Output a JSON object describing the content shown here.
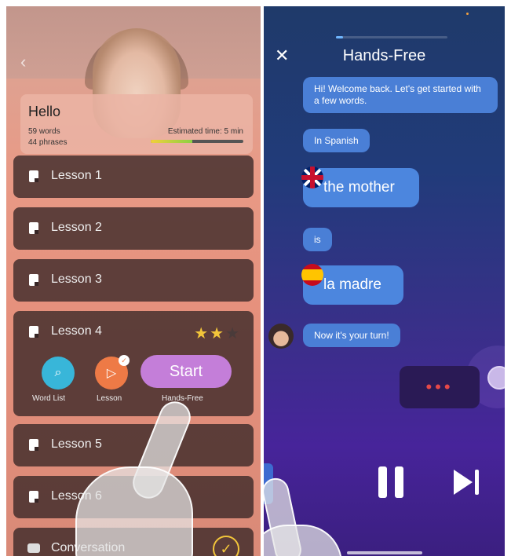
{
  "left_screen": {
    "back_icon": "chevron-left-icon",
    "header": {
      "title": "Hello",
      "words": "59 words",
      "phrases": "44 phrases",
      "estimated_time": "Estimated time: 5 min",
      "time_progress": 0.45
    },
    "lessons": [
      {
        "label": "Lesson 1"
      },
      {
        "label": "Lesson 2"
      },
      {
        "label": "Lesson 3"
      },
      {
        "label": "Lesson 4",
        "stars": 2,
        "stars_max": 3
      },
      {
        "label": "Lesson 5"
      },
      {
        "label": "Lesson 6"
      },
      {
        "label": "Conversation",
        "completed": true
      }
    ],
    "lesson4_actions": {
      "word_list": "Word List",
      "lesson": "Lesson",
      "start": "Start",
      "hands_free": "Hands-Free"
    },
    "colors": {
      "accent_star": "#f2c53a",
      "start_button": "#c47ed9",
      "word_list_button": "#38b6d9",
      "lesson_button": "#ee7a46"
    }
  },
  "right_screen": {
    "close_icon": "close-icon",
    "title": "Hands-Free",
    "progress": 0.06,
    "messages": [
      {
        "text": "Hi! Welcome back. Let's get started with a few words."
      },
      {
        "text": "In Spanish"
      },
      {
        "text": "the mother",
        "flag": "uk-flag-icon"
      },
      {
        "text": "is"
      },
      {
        "text": "la madre",
        "flag": "spain-flag-icon"
      },
      {
        "text": "Now it's your turn!"
      }
    ],
    "typing_indicator": "•••",
    "controls": {
      "pause_icon": "pause-icon",
      "next_icon": "skip-next-icon"
    },
    "colors": {
      "bubble": "#4a7fd6",
      "typing_dots": "#e54848"
    }
  }
}
